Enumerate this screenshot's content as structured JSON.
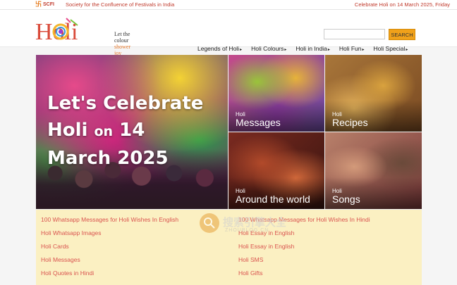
{
  "topbar": {
    "logo_text": "SCFI",
    "tagline": "Society for the Confluence of Festivals in India",
    "date_text": "Celebrate Holi on 14 March 2025, Friday"
  },
  "header": {
    "logo_word": "Holi",
    "logo_tagline_line1": "Let the colour",
    "logo_tagline_line2": "shower joy",
    "search_placeholder": "",
    "search_button": "SEARCH",
    "nav": [
      {
        "label": "Legends of Holi"
      },
      {
        "label": "Holi Colours"
      },
      {
        "label": "Holi in India"
      },
      {
        "label": "Holi Fun"
      },
      {
        "label": "Holi Special"
      }
    ]
  },
  "hero": {
    "line1": "Let's Celebrate",
    "line2_a": "Holi ",
    "line2_b": "on",
    "line2_c": " 14",
    "line3": "March 2025"
  },
  "tiles": [
    {
      "sub": "Holi",
      "main": "Messages"
    },
    {
      "sub": "Holi",
      "main": "Recipes"
    },
    {
      "sub": "Holi",
      "main": "Around the world"
    },
    {
      "sub": "Holi",
      "main": "Songs"
    }
  ],
  "links": {
    "left": [
      "100 Whatsapp Messages for Holi Wishes In English",
      "Holi Whatsapp Images",
      "Holi Cards",
      "Holi Messages",
      "Holi Quotes in Hindi"
    ],
    "right": [
      "100 Whatsapp Messages for Holi Wishes In Hindi",
      "Holi Essay in English",
      "Holi Essay in English",
      "Holi SMS",
      "Holi Gifts"
    ]
  },
  "watermark": {
    "big": "搜索引擎大全",
    "small": "ZHOUBLOG.CN"
  }
}
